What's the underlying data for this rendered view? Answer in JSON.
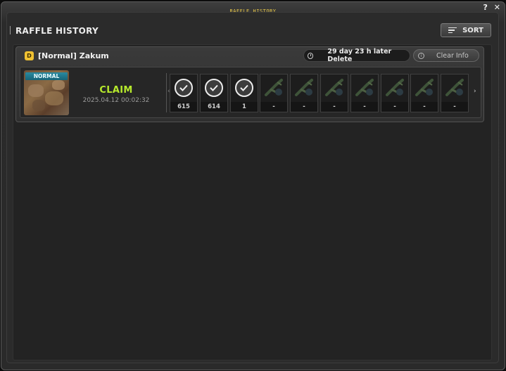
{
  "window": {
    "title": "RAFFLE HISTORY",
    "help_label": "?",
    "close_label": "✕"
  },
  "header": {
    "title": "RAFFLE HISTORY",
    "sort_label": "SORT"
  },
  "entry": {
    "badge": "D",
    "boss_name": "[Normal] Zakum",
    "delete_text": "29 day 23 h later Delete",
    "clear_label": "Clear Info",
    "difficulty_tag": "NORMAL",
    "status": "CLAIM",
    "date": "2025.04.12 00:02:32",
    "rewards": [
      {
        "claimed": true,
        "count": "615",
        "icon": "check-icon"
      },
      {
        "claimed": true,
        "count": "614",
        "icon": "check-icon"
      },
      {
        "claimed": true,
        "count": "1",
        "icon": "check-icon"
      },
      {
        "claimed": false,
        "count": "-",
        "icon": "bazooka-icon"
      },
      {
        "claimed": false,
        "count": "-",
        "icon": "crossbow-icon"
      },
      {
        "claimed": false,
        "count": "-",
        "icon": "gun-icon"
      },
      {
        "claimed": false,
        "count": "-",
        "icon": "cannon-icon"
      },
      {
        "claimed": false,
        "count": "-",
        "icon": "launcher-icon"
      },
      {
        "claimed": false,
        "count": "-",
        "icon": "rifle-icon"
      },
      {
        "claimed": false,
        "count": "-",
        "icon": "hammer-icon"
      }
    ]
  },
  "colors": {
    "claim": "#b7ea2c",
    "title": "#e9c94a",
    "badge": "#f1c232",
    "tag": "#2a8aa0"
  }
}
